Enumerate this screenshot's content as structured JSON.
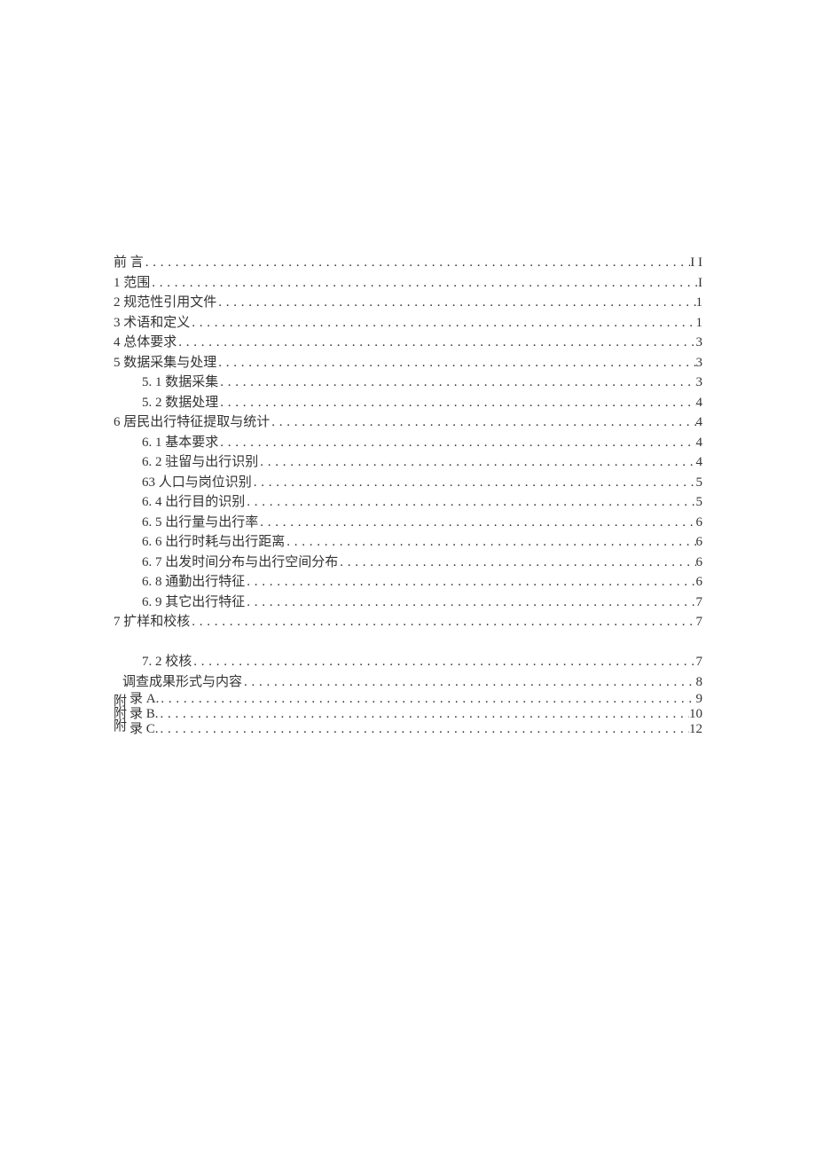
{
  "toc": {
    "entries": [
      {
        "indent": 0,
        "label": "前 言",
        "page": "I I"
      },
      {
        "indent": 0,
        "label": "1 范围",
        "page": "I"
      },
      {
        "indent": 0,
        "label": "2 规范性引用文件",
        "page": "1"
      },
      {
        "indent": 0,
        "label": "3 术语和定义",
        "page": "1"
      },
      {
        "indent": 0,
        "label": "4 总体要求",
        "page": "3"
      },
      {
        "indent": 0,
        "label": "5 数据采集与处理",
        "page": "3"
      },
      {
        "indent": 1,
        "label": "5. 1  数据采集",
        "page": "3"
      },
      {
        "indent": 1,
        "label": "5. 2  数据处理",
        "page": "4"
      },
      {
        "indent": 0,
        "label": "6 居民出行特征提取与统计",
        "page": "4"
      },
      {
        "indent": 1,
        "label": "6. 1  基本要求",
        "page": "4"
      },
      {
        "indent": 1,
        "label": "6. 2  驻留与出行识别",
        "page": "4"
      },
      {
        "indent": 1,
        "label": "63 人口与岗位识别",
        "page": "5"
      },
      {
        "indent": 1,
        "label": "6. 4  出行目的识别",
        "page": "5"
      },
      {
        "indent": 1,
        "label": "6. 5  出行量与出行率",
        "page": "6"
      },
      {
        "indent": 1,
        "label": "6. 6  出行时耗与出行距离",
        "page": "6"
      },
      {
        "indent": 1,
        "label": "6. 7  出发时间分布与出行空间分布",
        "page": "6"
      },
      {
        "indent": 1,
        "label": "6. 8  通勤出行特征",
        "page": "6"
      },
      {
        "indent": 1,
        "label": "6. 9  其它出行特征",
        "page": "7"
      },
      {
        "indent": 0,
        "label": "7 扩样和校核",
        "page": "7"
      }
    ],
    "after_gap": [
      {
        "indent": 1,
        "label": "7. 2 校核",
        "page": "7"
      },
      {
        "indent": 0.5,
        "label": "调查成果形式与内容",
        "page": "8"
      }
    ],
    "appendix": {
      "prefix_lines": [
        "附",
        "附",
        "附"
      ],
      "rows": [
        {
          "label": "录 A.",
          "page": "9"
        },
        {
          "label": "录 B.",
          "page": "10"
        },
        {
          "label": "录 C.",
          "page": "12"
        }
      ]
    }
  }
}
